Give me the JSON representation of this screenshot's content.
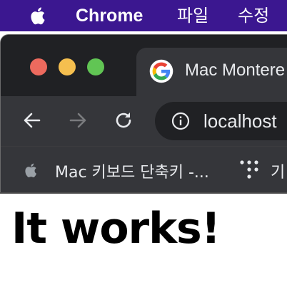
{
  "menubar": {
    "app_name": "Chrome",
    "items": [
      "파일",
      "수정"
    ]
  },
  "browser": {
    "tab": {
      "title": "Mac Montere"
    },
    "omnibox": {
      "url": "localhost"
    },
    "bookmarks": [
      {
        "label": "Mac 키보드 단축키 -..."
      },
      {
        "label": "기"
      }
    ]
  },
  "page": {
    "heading": "It works!"
  },
  "colors": {
    "menubar_bg": "#3b1790",
    "browser_frame": "#202124",
    "toolbar_bg": "#35363a",
    "close": "#ed6a5e",
    "minimize": "#f5bf4f",
    "maximize": "#61c554"
  }
}
